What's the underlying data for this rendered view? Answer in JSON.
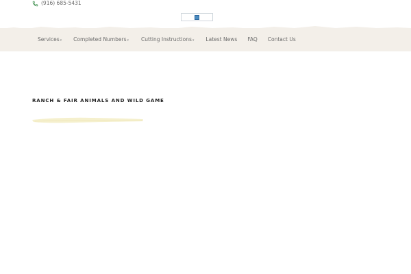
{
  "topbar": {
    "phone": "(916) 685-5431",
    "phone_icon": "phone-icon"
  },
  "header": {
    "logo_icon": "image-placeholder-icon"
  },
  "nav": {
    "items": [
      {
        "label": "Services",
        "has_dropdown": true
      },
      {
        "label": "Completed Numbers",
        "has_dropdown": true
      },
      {
        "label": "Cutting Instructions",
        "has_dropdown": true
      },
      {
        "label": "Latest News",
        "has_dropdown": false
      },
      {
        "label": "FAQ",
        "has_dropdown": false
      },
      {
        "label": "Contact Us",
        "has_dropdown": false
      }
    ],
    "dropdown_marker": "▾"
  },
  "main": {
    "title": "RANCH & FAIR ANIMALS AND WILD GAME"
  },
  "colors": {
    "nav_background": "#f3efe9",
    "nav_text": "#6a6a6a",
    "accent_green": "#3f8f4f",
    "underline_yellow": "#f4eec8"
  }
}
